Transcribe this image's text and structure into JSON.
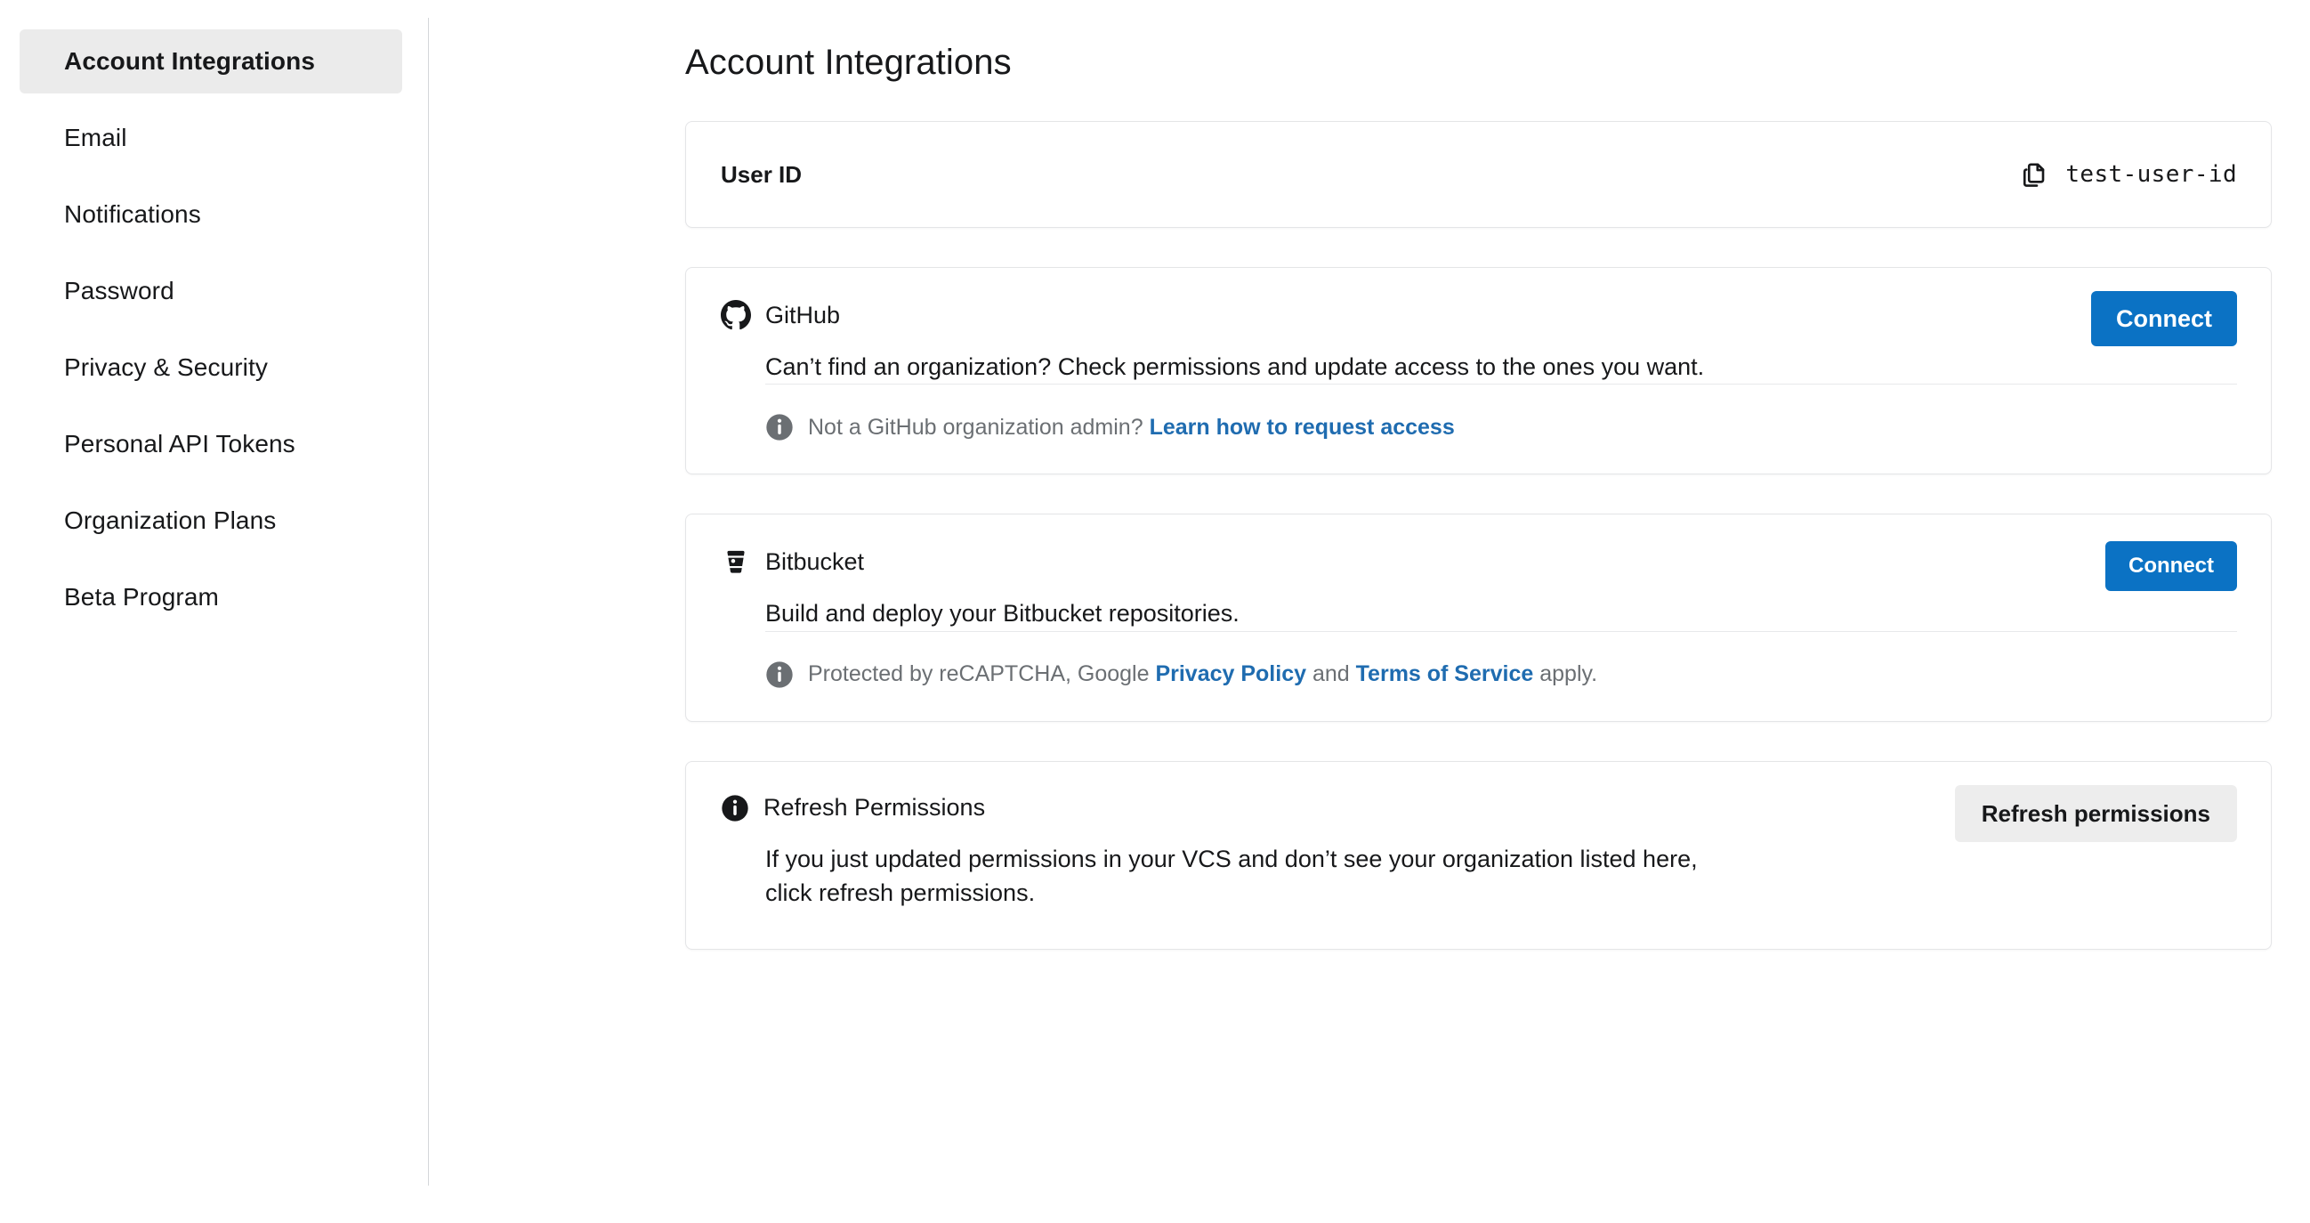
{
  "sidebar": {
    "items": [
      {
        "label": "Account Integrations",
        "active": true
      },
      {
        "label": "Email",
        "active": false
      },
      {
        "label": "Notifications",
        "active": false
      },
      {
        "label": "Password",
        "active": false
      },
      {
        "label": "Privacy & Security",
        "active": false
      },
      {
        "label": "Personal API Tokens",
        "active": false
      },
      {
        "label": "Organization Plans",
        "active": false
      },
      {
        "label": "Beta Program",
        "active": false
      }
    ]
  },
  "main": {
    "title": "Account Integrations",
    "user_id_card": {
      "label": "User ID",
      "value": "test-user-id",
      "copy_icon": "copy-icon"
    },
    "github_card": {
      "icon": "github-icon",
      "name": "GitHub",
      "description": "Can’t find an organization? Check permissions and update access to the ones you want.",
      "button_label": "Connect",
      "footer_icon": "info-circle-icon",
      "footer_text": "Not a GitHub organization admin?",
      "footer_link": "Learn how to request access"
    },
    "bitbucket_card": {
      "icon": "bitbucket-icon",
      "name": "Bitbucket",
      "description": "Build and deploy your Bitbucket repositories.",
      "button_label": "Connect",
      "footer_icon": "info-circle-icon",
      "footer_prefix": "Protected by reCAPTCHA, Google",
      "footer_link_privacy": "Privacy Policy",
      "footer_conjunction": "and",
      "footer_link_terms": "Terms of Service",
      "footer_suffix": "apply."
    },
    "refresh_card": {
      "icon": "info-circle-filled-icon",
      "name": "Refresh Permissions",
      "description": "If you just updated permissions in your VCS and don’t see your organization listed here, click refresh permissions.",
      "button_label": "Refresh permissions"
    }
  },
  "colors": {
    "accent_blue": "#0b72c4",
    "link_blue": "#1f6cb0",
    "active_nav_bg": "#ebebeb",
    "secondary_button_bg": "#ededed",
    "card_border": "#e4e5e7",
    "muted_text": "#6b6f73"
  }
}
